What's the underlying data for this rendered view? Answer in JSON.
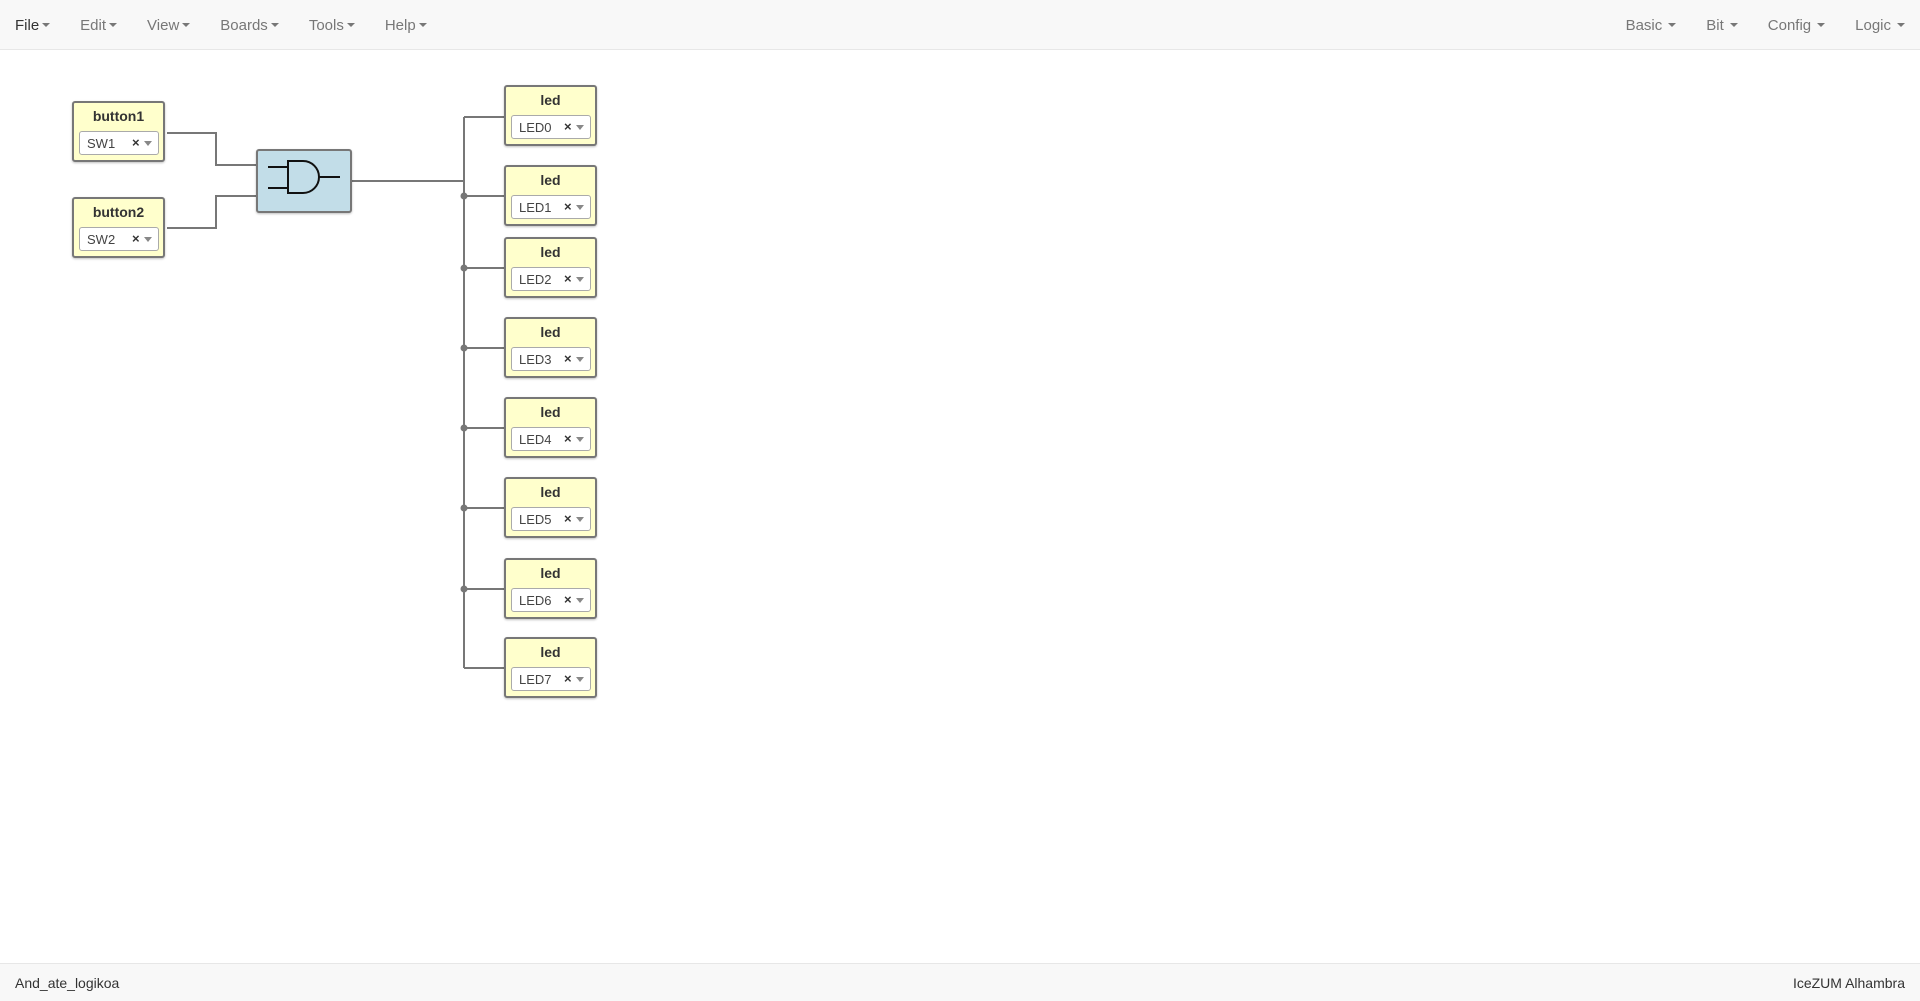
{
  "menu": {
    "left": [
      {
        "label": "File"
      },
      {
        "label": "Edit"
      },
      {
        "label": "View"
      },
      {
        "label": "Boards"
      },
      {
        "label": "Tools"
      },
      {
        "label": "Help"
      }
    ],
    "right": [
      {
        "label": "Basic"
      },
      {
        "label": "Bit"
      },
      {
        "label": "Config"
      },
      {
        "label": "Logic"
      }
    ]
  },
  "blocks": {
    "buttons": [
      {
        "title": "button1",
        "pin": "SW1",
        "clear": "×"
      },
      {
        "title": "button2",
        "pin": "SW2",
        "clear": "×"
      }
    ],
    "gate": {
      "type": "and-gate-icon"
    },
    "leds": [
      {
        "title": "led",
        "pin": "LED0",
        "clear": "×"
      },
      {
        "title": "led",
        "pin": "LED1",
        "clear": "×"
      },
      {
        "title": "led",
        "pin": "LED2",
        "clear": "×"
      },
      {
        "title": "led",
        "pin": "LED3",
        "clear": "×"
      },
      {
        "title": "led",
        "pin": "LED4",
        "clear": "×"
      },
      {
        "title": "led",
        "pin": "LED5",
        "clear": "×"
      },
      {
        "title": "led",
        "pin": "LED6",
        "clear": "×"
      },
      {
        "title": "led",
        "pin": "LED7",
        "clear": "×"
      }
    ]
  },
  "status": {
    "project_name": "And_ate_logikoa",
    "board_name": "IceZUM Alhambra"
  },
  "colors": {
    "block_fill": "#ffffcc",
    "gate_fill": "#c2dde8",
    "wire": "#777777",
    "bar_background": "#f8f8f8"
  }
}
